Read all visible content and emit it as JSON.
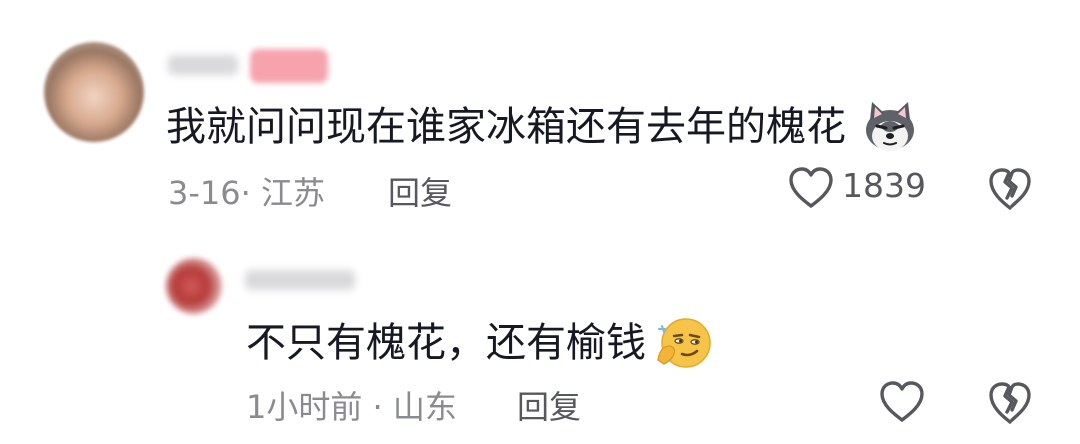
{
  "comments": [
    {
      "text": "我就问问现在谁家冰箱还有去年的槐花",
      "date_location": "3-16· 江苏",
      "reply_label": "回复",
      "like_count": "1839",
      "emoji": "husky-dog-face"
    },
    {
      "text": "不只有槐花，还有榆钱",
      "date_location": "1小时前 · 山东",
      "reply_label": "回复",
      "emoji": "smirking-face"
    }
  ],
  "icons": {
    "like": "heart-outline-icon",
    "dislike": "broken-heart-outline-icon"
  },
  "colors": {
    "text_primary": "#161823",
    "text_meta": "#8a8b91",
    "icon": "#57585e",
    "badge": "#f6a3ad"
  }
}
